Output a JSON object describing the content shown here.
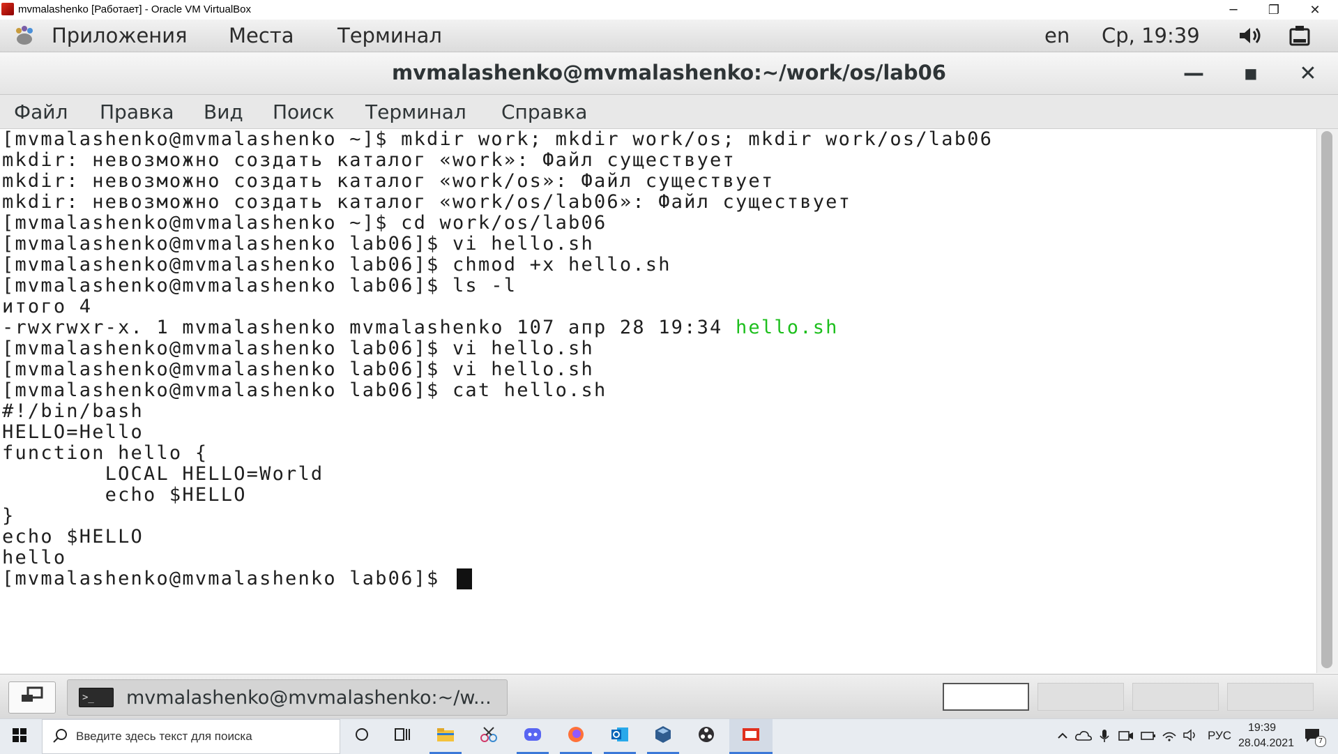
{
  "vbox": {
    "title": "mvmalashenko [Работает] - Oracle VM VirtualBox",
    "minimize": "─",
    "restore": "❐",
    "close": "✕"
  },
  "gnome_panel": {
    "apps": "Приложения",
    "places": "Места",
    "terminal": "Терминал",
    "lang": "en",
    "clock": "Ср, 19:39"
  },
  "terminal_window": {
    "title": "mvmalashenko@mvmalashenko:~/work/os/lab06",
    "minimize": "—",
    "maximize": "■",
    "close": "✕",
    "menu": [
      "Файл",
      "Правка",
      "Вид",
      "Поиск",
      "Терминал",
      "Справка"
    ]
  },
  "terminal": {
    "lines": [
      "[mvmalashenko@mvmalashenko ~]$ mkdir work; mkdir work/os; mkdir work/os/lab06",
      "mkdir: невозможно создать каталог «work»: Файл существует",
      "mkdir: невозможно создать каталог «work/os»: Файл существует",
      "mkdir: невозможно создать каталог «work/os/lab06»: Файл существует",
      "[mvmalashenko@mvmalashenko ~]$ cd work/os/lab06",
      "[mvmalashenko@mvmalashenko lab06]$ vi hello.sh",
      "[mvmalashenko@mvmalashenko lab06]$ chmod +x hello.sh",
      "[mvmalashenko@mvmalashenko lab06]$ ls -l",
      "итого 4",
      "-rwxrwxr-x. 1 mvmalashenko mvmalashenko 107 апр 28 19:34 ",
      "[mvmalashenko@mvmalashenko lab06]$ vi hello.sh",
      "[mvmalashenko@mvmalashenko lab06]$ vi hello.sh",
      "[mvmalashenko@mvmalashenko lab06]$ cat hello.sh",
      "#!/bin/bash",
      "HELLO=Hello",
      "function hello {",
      "        LOCAL HELLO=World",
      "        echo $HELLO",
      "}",
      "echo $HELLO",
      "hello",
      "[mvmalashenko@mvmalashenko lab06]$ "
    ],
    "ls_filename": "hello.sh",
    "filename_color": "#1dbf1d"
  },
  "bottom_panel": {
    "task_label": "mvmalashenko@mvmalashenko:~/w...",
    "task_icon_text": ">_"
  },
  "win_taskbar": {
    "search_placeholder": "Введите здесь текст для поиска",
    "lang": "РУС",
    "time": "19:39",
    "date": "28.04.2021",
    "notif_count": "7"
  }
}
